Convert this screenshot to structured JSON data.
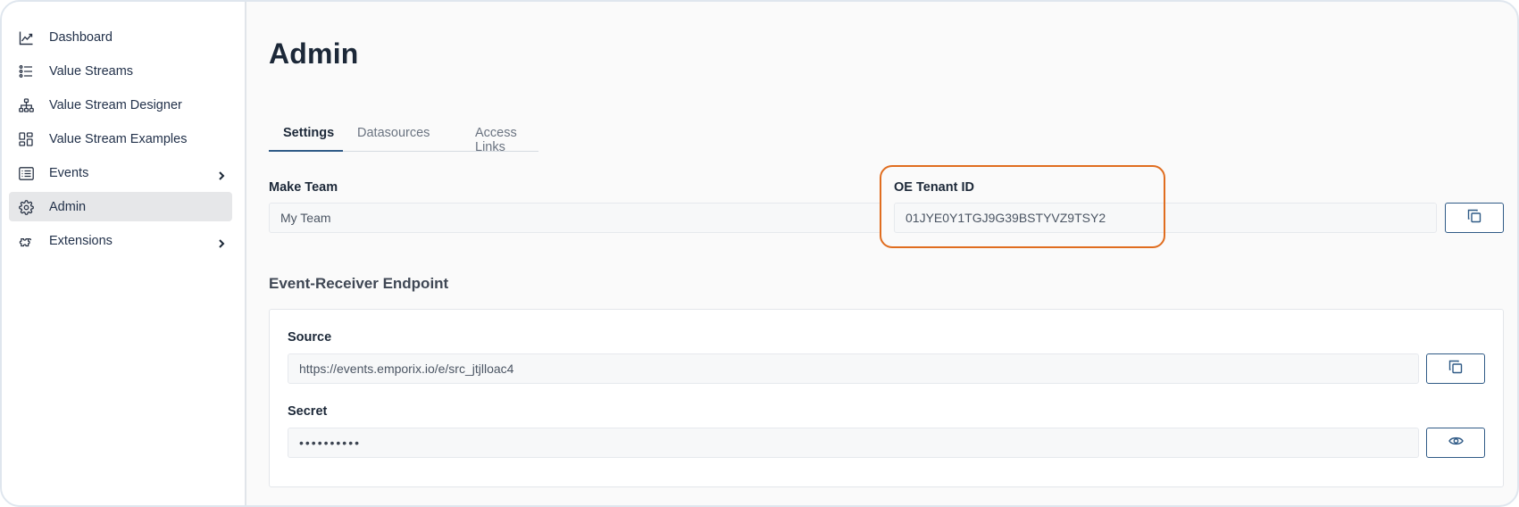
{
  "sidebar": {
    "items": [
      {
        "label": "Dashboard",
        "icon": "chart-line-icon"
      },
      {
        "label": "Value Streams",
        "icon": "list-icon"
      },
      {
        "label": "Value Stream Designer",
        "icon": "sitemap-icon"
      },
      {
        "label": "Value Stream Examples",
        "icon": "dashboard-grid-icon"
      },
      {
        "label": "Events",
        "icon": "events-list-icon",
        "expandable": true
      },
      {
        "label": "Admin",
        "icon": "gear-icon",
        "active": true
      },
      {
        "label": "Extensions",
        "icon": "puzzle-icon",
        "expandable": true
      }
    ]
  },
  "page": {
    "title": "Admin"
  },
  "tabs": [
    {
      "label": "Settings",
      "active": true
    },
    {
      "label": "Datasources",
      "active": false
    },
    {
      "label": "Access Links",
      "active": false
    }
  ],
  "settings": {
    "make_team_label": "Make Team",
    "make_team_value": "My Team",
    "tenant_label": "OE Tenant ID",
    "tenant_value": "01JYE0Y1TGJ9G39BSTYVZ9TSY2"
  },
  "endpoint": {
    "section_title": "Event-Receiver Endpoint",
    "source_label": "Source",
    "source_value": "https://events.emporix.io/e/src_jtjlloac4",
    "secret_label": "Secret",
    "secret_value": "••••••••••"
  },
  "colors": {
    "accent": "#2f5a86",
    "highlight": "#e06d1f",
    "active_nav_bg": "#e6e7e9"
  }
}
